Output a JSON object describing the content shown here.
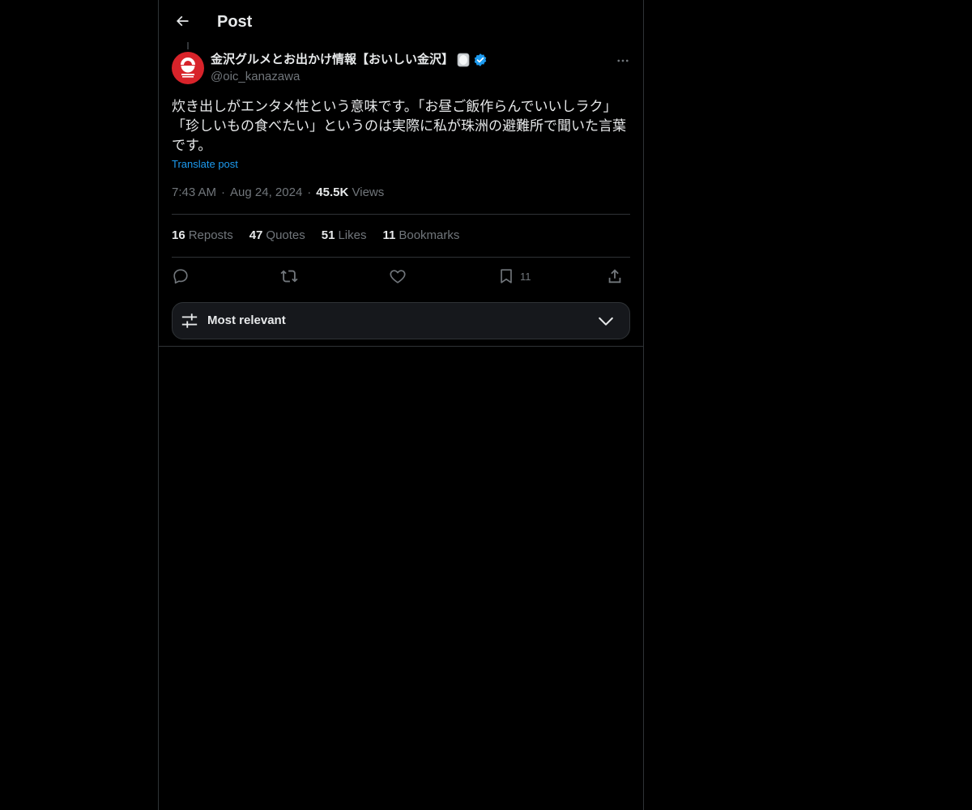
{
  "header": {
    "title": "Post",
    "back_icon": "arrow-left-icon"
  },
  "post": {
    "author": {
      "name": "金沢グルメとお出かけ情報【おいしい金沢】",
      "handle": "@oic_kanazawa",
      "verified": true,
      "avatar_color": "#d8232a"
    },
    "text": "炊き出しがエンタメ性という意味です。「お昼ご飯作らんでいいしラク」「珍しいもの食べたい」というのは実際に私が珠洲の避難所で聞いた言葉です。",
    "translate_label": "Translate post",
    "time": "7:43 AM",
    "date": "Aug 24, 2024",
    "views_count": "45.5K",
    "views_label": "Views",
    "stats": {
      "reposts": {
        "count": "16",
        "label": "Reposts"
      },
      "quotes": {
        "count": "47",
        "label": "Quotes"
      },
      "likes": {
        "count": "51",
        "label": "Likes"
      },
      "bookmarks": {
        "count": "11",
        "label": "Bookmarks"
      }
    },
    "actions": {
      "reply_icon": "reply-icon",
      "repost_icon": "repost-icon",
      "like_icon": "heart-icon",
      "bookmark_icon": "bookmark-icon",
      "bookmark_count": "11",
      "share_icon": "share-icon"
    }
  },
  "replies_sort": {
    "label": "Most relevant",
    "icon": "sliders-icon",
    "chevron": "chevron-down-icon"
  },
  "colors": {
    "background": "#000000",
    "text_primary": "#e7e9ea",
    "text_secondary": "#71767b",
    "accent": "#1d9bf0",
    "border": "#2f3336"
  }
}
